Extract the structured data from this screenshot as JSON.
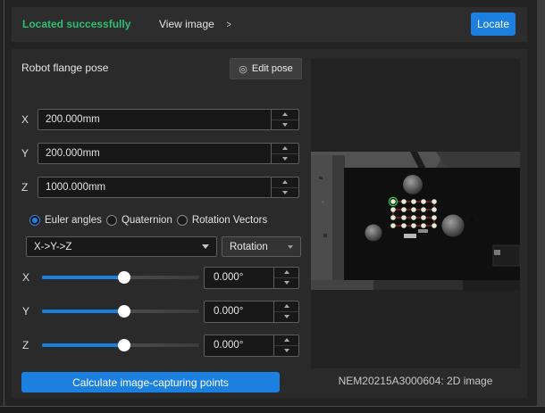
{
  "top_bar": {
    "status_text": "Located successfully",
    "view_image_label": "View image",
    "view_image_chevron": ">",
    "locate_button": "Locate"
  },
  "pose_panel": {
    "title": "Robot flange pose",
    "edit_pose_button": "Edit pose",
    "edit_pose_icon": "◎",
    "fields": [
      {
        "label": "X",
        "value": "200.000mm"
      },
      {
        "label": "Y",
        "value": "200.000mm"
      },
      {
        "label": "Z",
        "value": "1000.000mm"
      }
    ],
    "rotation_formats": [
      {
        "label": "Euler angles",
        "selected": true
      },
      {
        "label": "Quaternion",
        "selected": false
      },
      {
        "label": "Rotation Vectors",
        "selected": false
      }
    ],
    "euler_order_value": "X->Y->Z",
    "rotation_type_value": "Rotation",
    "sliders": [
      {
        "label": "X",
        "value": "0.000°",
        "percent": 52
      },
      {
        "label": "Y",
        "value": "0.000°",
        "percent": 52
      },
      {
        "label": "Z",
        "value": "0.000°",
        "percent": 52
      }
    ],
    "calculate_button": "Calculate image-capturing points"
  },
  "image_panel": {
    "caption": "NEM20215A3000604: 2D image"
  },
  "colors": {
    "accent_blue": "#1b80e0",
    "success_green": "#2fbf71"
  }
}
